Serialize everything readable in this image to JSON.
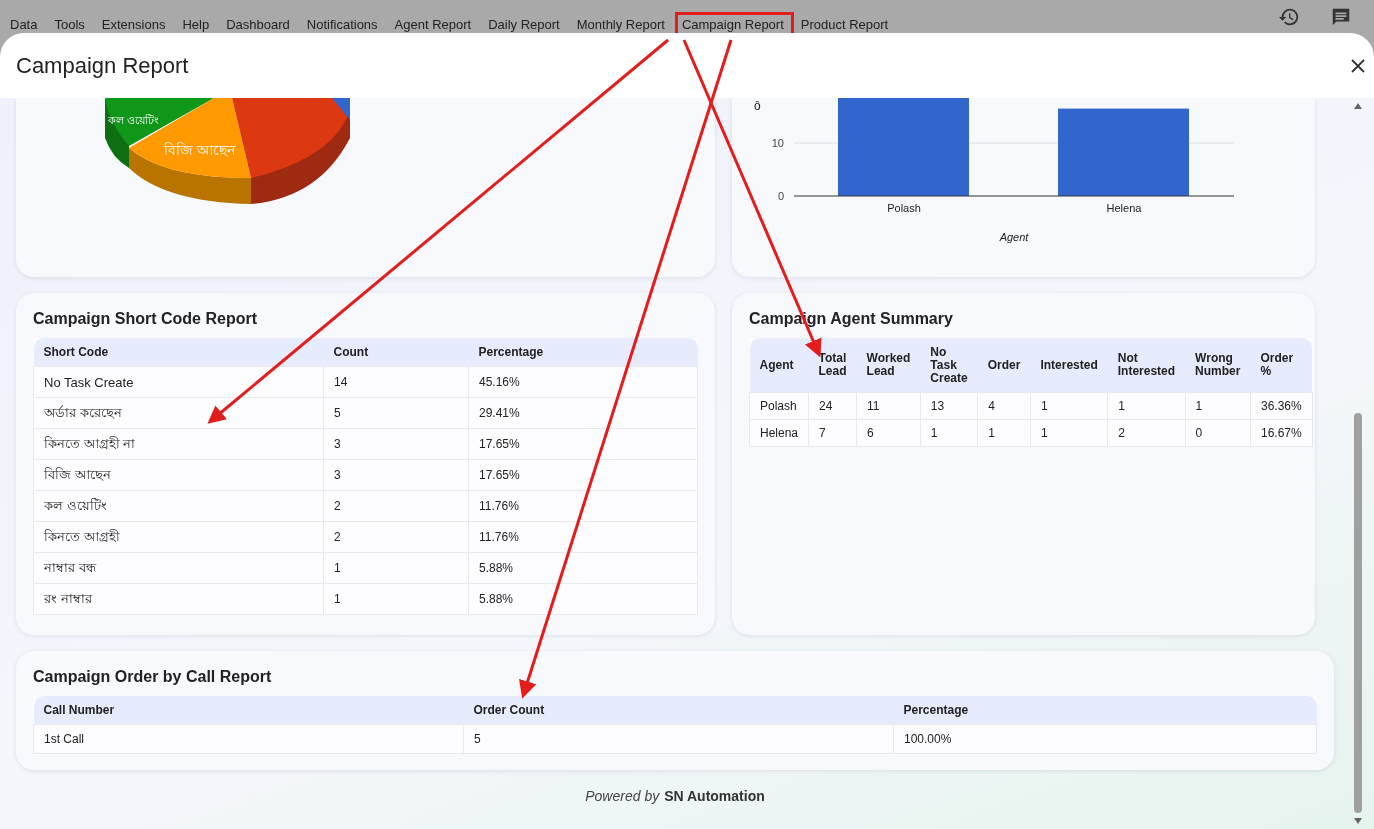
{
  "menu": [
    {
      "label": "Data",
      "highlighted": false
    },
    {
      "label": "Tools",
      "highlighted": false
    },
    {
      "label": "Extensions",
      "highlighted": false
    },
    {
      "label": "Help",
      "highlighted": false
    },
    {
      "label": "Dashboard",
      "highlighted": false
    },
    {
      "label": "Notifications",
      "highlighted": false
    },
    {
      "label": "Agent Report",
      "highlighted": false
    },
    {
      "label": "Daily Report",
      "highlighted": false
    },
    {
      "label": "Monthly Report",
      "highlighted": false
    },
    {
      "label": "Campaign Report",
      "highlighted": true
    },
    {
      "label": "Product Report",
      "highlighted": false
    }
  ],
  "dialog": {
    "title": "Campaign Report"
  },
  "pie": {
    "labels": [
      "কল ওয়েটিং",
      "বিজি আছেন"
    ]
  },
  "agent_chart": {
    "chart_data": {
      "type": "bar",
      "xlabel": "Agent",
      "ylabel": "ô",
      "categories": [
        "Polash",
        "Helena"
      ],
      "series": [
        {
          "color": "#3366cc",
          "values": [
            18.5,
            16.5
          ]
        }
      ],
      "ylim": [
        0,
        18.5
      ],
      "yticks": [
        0,
        10
      ]
    }
  },
  "short_code_report": {
    "title": "Campaign Short Code Report",
    "columns": [
      "Short Code",
      "Count",
      "Percentage"
    ],
    "rows": [
      [
        "No Task Create",
        "14",
        "45.16%"
      ],
      [
        "অর্ডার করেছেন",
        "5",
        "29.41%"
      ],
      [
        "কিনতে আগ্রহী না",
        "3",
        "17.65%"
      ],
      [
        "বিজি আছেন",
        "3",
        "17.65%"
      ],
      [
        "কল ওয়েটিং",
        "2",
        "11.76%"
      ],
      [
        "কিনতে আগ্রহী",
        "2",
        "11.76%"
      ],
      [
        "নাম্বার বন্ধ",
        "1",
        "5.88%"
      ],
      [
        "রং নাম্বার",
        "1",
        "5.88%"
      ]
    ]
  },
  "agent_summary": {
    "title": "Campaign Agent Summary",
    "columns": [
      "Agent",
      "Total Lead",
      "Worked Lead",
      "No Task Create",
      "Order",
      "Interested",
      "Not Interested",
      "Wrong Number",
      "Order %"
    ],
    "rows": [
      [
        "Polash",
        "24",
        "11",
        "13",
        "4",
        "1",
        "1",
        "1",
        "36.36%"
      ],
      [
        "Helena",
        "7",
        "6",
        "1",
        "1",
        "1",
        "2",
        "0",
        "16.67%"
      ]
    ]
  },
  "order_by_call": {
    "title": "Campaign Order by Call Report",
    "columns": [
      "Call Number",
      "Order Count",
      "Percentage"
    ],
    "rows": [
      [
        "1st Call",
        "5",
        "100.00%"
      ]
    ]
  },
  "footer": {
    "prefix": "Powered by",
    "brand": "SN Automation"
  }
}
